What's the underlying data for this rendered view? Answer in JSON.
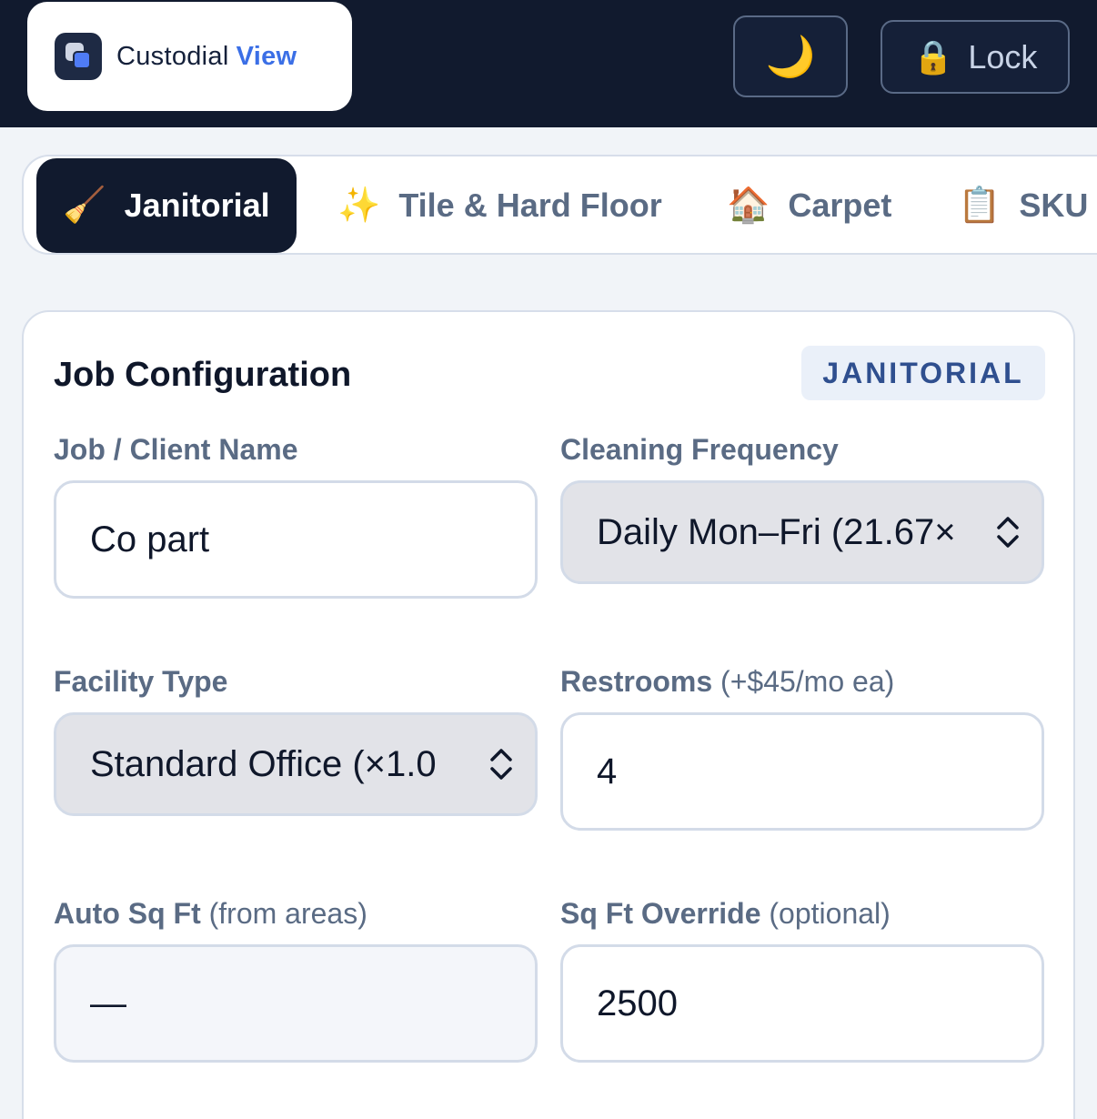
{
  "header": {
    "logo_text": "Custodial",
    "logo_accent": "View",
    "theme_icon": "🌙",
    "lock_icon": "🔒",
    "lock_label": "Lock"
  },
  "tabs": [
    {
      "icon": "🧹",
      "label": "Janitorial",
      "active": true
    },
    {
      "icon": "✨",
      "label": "Tile & Hard Floor",
      "active": false
    },
    {
      "icon": "🏠",
      "label": "Carpet",
      "active": false
    },
    {
      "icon": "📋",
      "label": "SKU F",
      "active": false
    }
  ],
  "card": {
    "title": "Job Configuration",
    "badge": "JANITORIAL",
    "fields": {
      "job_name": {
        "label": "Job / Client Name",
        "value": "Co part"
      },
      "frequency": {
        "label": "Cleaning Frequency",
        "value": "Daily Mon–Fri (21.67×"
      },
      "facility": {
        "label": "Facility Type",
        "value": "Standard Office (×1.0"
      },
      "restrooms": {
        "label": "Restrooms",
        "hint": "(+$45/mo ea)",
        "value": "4"
      },
      "auto_sqft": {
        "label": "Auto Sq Ft",
        "hint": "(from areas)",
        "value": "—"
      },
      "sqft_override": {
        "label": "Sq Ft Override",
        "hint": "(optional)",
        "value": "2500"
      }
    }
  },
  "colors": {
    "header_bg": "#111a2e",
    "accent": "#3b6fe6",
    "badge_text": "#2f4f8f",
    "label": "#5a6b84"
  }
}
